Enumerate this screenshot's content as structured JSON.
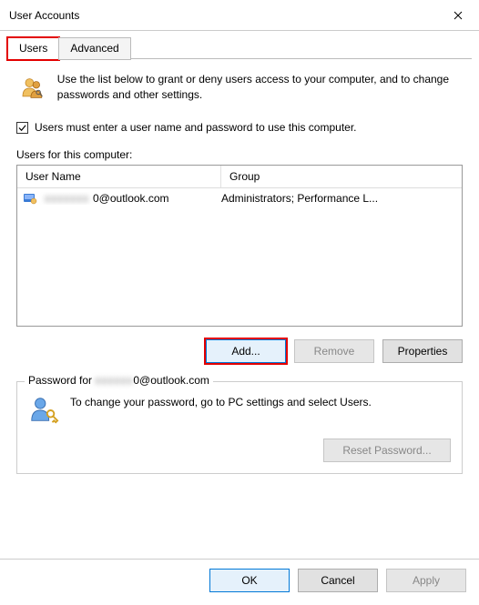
{
  "window": {
    "title": "User Accounts"
  },
  "tabs": {
    "users": "Users",
    "advanced": "Advanced"
  },
  "intro": "Use the list below to grant or deny users access to your computer, and to change passwords and other settings.",
  "checkbox": {
    "label": "Users must enter a user name and password to use this computer.",
    "checked": true
  },
  "list": {
    "label": "Users for this computer:",
    "columns": {
      "user": "User Name",
      "group": "Group"
    },
    "rows": [
      {
        "name_prefix": "­",
        "blurred": "xxxxxxx",
        "name_suffix": "0@outlook.com",
        "group": "Administrators; Performance L..."
      }
    ]
  },
  "buttons": {
    "add": "Add...",
    "remove": "Remove",
    "properties": "Properties"
  },
  "password_group": {
    "legend_prefix": "Password for ",
    "legend_blur": "xxxxxx",
    "legend_suffix": "0@outlook.com",
    "text": "To change your password, go to PC settings and select Users.",
    "reset": "Reset Password..."
  },
  "footer": {
    "ok": "OK",
    "cancel": "Cancel",
    "apply": "Apply"
  }
}
